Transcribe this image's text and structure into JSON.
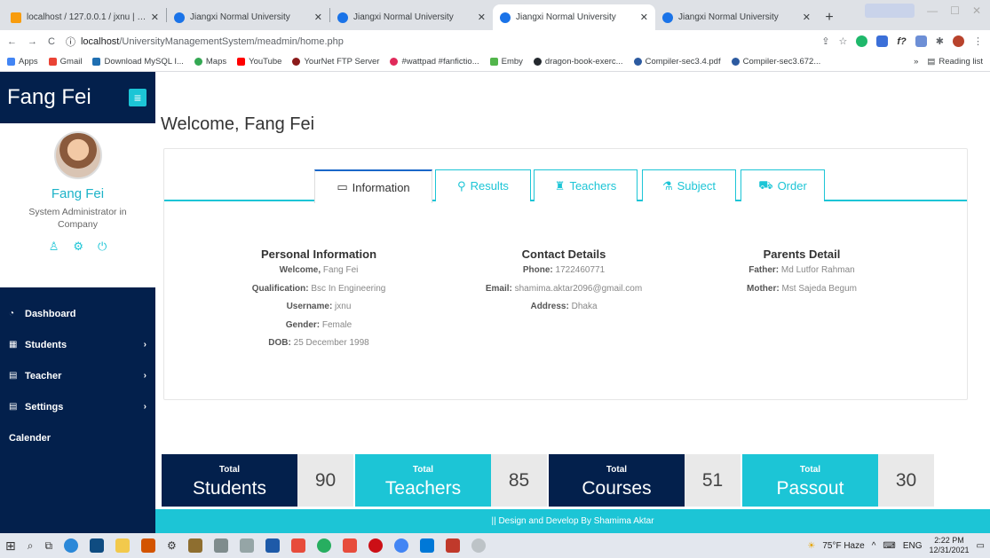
{
  "browser": {
    "tabs": [
      {
        "title": "localhost / 127.0.0.1 / jxnu | php",
        "active": false
      },
      {
        "title": "Jiangxi Normal University",
        "active": false
      },
      {
        "title": "Jiangxi Normal University",
        "active": false
      },
      {
        "title": "Jiangxi Normal University",
        "active": true
      },
      {
        "title": "Jiangxi Normal University",
        "active": false
      }
    ],
    "url_host": "localhost",
    "url_path": "/UniversityManagementSystem/meadmin/home.php",
    "bookmarks": [
      "Apps",
      "Gmail",
      "Download MySQL I...",
      "Maps",
      "YouTube",
      "YourNet FTP Server",
      "#wattpad #fanfictio...",
      "Emby",
      "dragon-book-exerc...",
      "Compiler-sec3.4.pdf",
      "Compiler-sec3.672..."
    ],
    "reading_list": "Reading list",
    "overflow": "»"
  },
  "sidebar": {
    "brand": "Fang Fei",
    "toggle_icon": "≡",
    "user_name": "Fang Fei",
    "user_role": "System Administrator in Company",
    "menu": [
      {
        "label": "Dashboard",
        "icon": "dashboard-icon",
        "glyph": "◔",
        "arrow": ""
      },
      {
        "label": "Students",
        "icon": "table-icon",
        "glyph": "▦",
        "arrow": "›"
      },
      {
        "label": "Teacher",
        "icon": "document-icon",
        "glyph": "▤",
        "arrow": "›"
      },
      {
        "label": "Settings",
        "icon": "document-icon",
        "glyph": "▤",
        "arrow": "›"
      },
      {
        "label": "Calender",
        "icon": "",
        "glyph": "",
        "arrow": ""
      }
    ]
  },
  "main": {
    "welcome": "Welcome, Fang Fei",
    "tabs": [
      {
        "label": "Information",
        "glyph": "▭"
      },
      {
        "label": "Results",
        "glyph": "⚲"
      },
      {
        "label": "Teachers",
        "glyph": "♜"
      },
      {
        "label": "Subject",
        "glyph": "⚗"
      },
      {
        "label": "Order",
        "glyph": "⛟"
      }
    ],
    "personal": {
      "heading": "Personal Information",
      "rows": [
        {
          "k": "Welcome,",
          "v": " Fang Fei"
        },
        {
          "k": "Qualification:",
          "v": " Bsc In Engineering"
        },
        {
          "k": "Username:",
          "v": " jxnu"
        },
        {
          "k": "Gender:",
          "v": " Female"
        },
        {
          "k": "DOB:",
          "v": " 25 December 1998"
        }
      ]
    },
    "contact": {
      "heading": "Contact Details",
      "rows": [
        {
          "k": "Phone:",
          "v": " 1722460771"
        },
        {
          "k": "Email:",
          "v": " shamima.aktar2096@gmail.com"
        },
        {
          "k": "Address:",
          "v": " Dhaka"
        }
      ]
    },
    "parents": {
      "heading": "Parents Detail",
      "rows": [
        {
          "k": "Father:",
          "v": " Md Lutfor Rahman"
        },
        {
          "k": "Mother:",
          "v": " Mst Sajeda Begum"
        }
      ]
    },
    "stats": [
      {
        "label_top": "Total",
        "label": "Students",
        "value": "90",
        "color": "#03204c"
      },
      {
        "label_top": "Total",
        "label": "Teachers",
        "value": "85",
        "color": "#1cc5d6"
      },
      {
        "label_top": "Total",
        "label": "Courses",
        "value": "51",
        "color": "#03204c"
      },
      {
        "label_top": "Total",
        "label": "Passout",
        "value": "30",
        "color": "#1cc5d6"
      }
    ],
    "footer": "|| Design and Develop By Shamima Aktar"
  },
  "taskbar": {
    "weather": "75°F Haze",
    "lang": "ENG",
    "time": "2:22 PM",
    "date": "12/31/2021"
  },
  "colors": {
    "navy": "#03204c",
    "accent": "#1cc5d6",
    "active_border": "#1a67c9"
  }
}
